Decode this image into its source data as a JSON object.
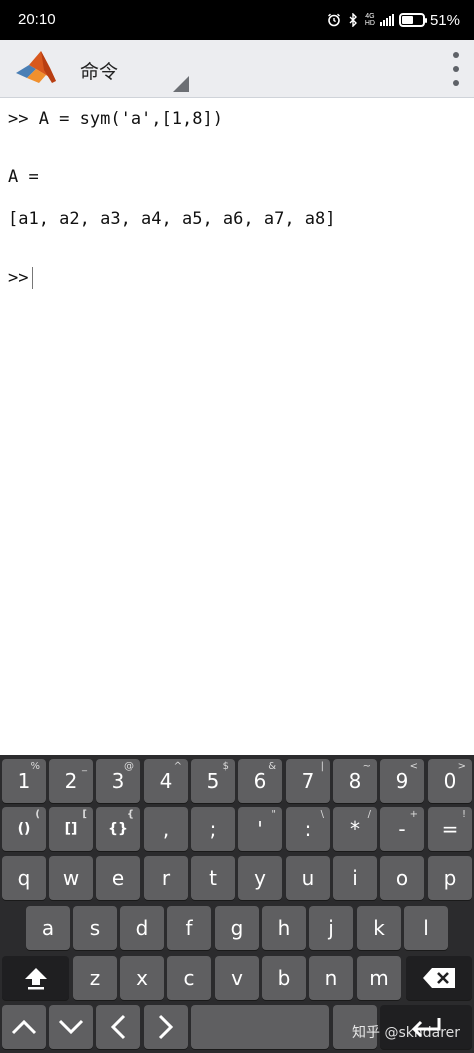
{
  "status_bar": {
    "time": "20:10",
    "network_tag_top": "4G",
    "network_tag_bottom": "HD",
    "battery": "51%"
  },
  "app_bar": {
    "title": "命令"
  },
  "console": {
    "lines": [
      ">> A = sym('a',[1,8])",
      "A =",
      "[a1, a2, a3, a4, a5, a6, a7, a8]",
      ">>"
    ]
  },
  "keyboard": {
    "row1": [
      {
        "label": "1",
        "sub": "%"
      },
      {
        "label": "2",
        "sub": "_"
      },
      {
        "label": "3",
        "sub": "@"
      },
      {
        "label": "4",
        "sub": "^"
      },
      {
        "label": "5",
        "sub": "$"
      },
      {
        "label": "6",
        "sub": "&"
      },
      {
        "label": "7",
        "sub": "|"
      },
      {
        "label": "8",
        "sub": "~"
      },
      {
        "label": "9",
        "sub": "<"
      },
      {
        "label": "0",
        "sub": ">"
      }
    ],
    "row2": [
      {
        "label": "()",
        "sub": "("
      },
      {
        "label": "[]",
        "sub": "["
      },
      {
        "label": "{}",
        "sub": "{"
      },
      {
        "label": ",",
        "sub": ""
      },
      {
        "label": ";",
        "sub": ""
      },
      {
        "label": "'",
        "sub": "\""
      },
      {
        "label": ":",
        "sub": "\\"
      },
      {
        "label": "*",
        "sub": "/"
      },
      {
        "label": "-",
        "sub": "+"
      },
      {
        "label": "=",
        "sub": "!"
      }
    ],
    "row3": [
      "q",
      "w",
      "e",
      "r",
      "t",
      "y",
      "u",
      "i",
      "o",
      "p"
    ],
    "row4": [
      "a",
      "s",
      "d",
      "f",
      "g",
      "h",
      "j",
      "k",
      "l"
    ],
    "row5": [
      "z",
      "x",
      "c",
      "v",
      "b",
      "n",
      "m"
    ]
  },
  "watermark": "知乎 @skndarer"
}
